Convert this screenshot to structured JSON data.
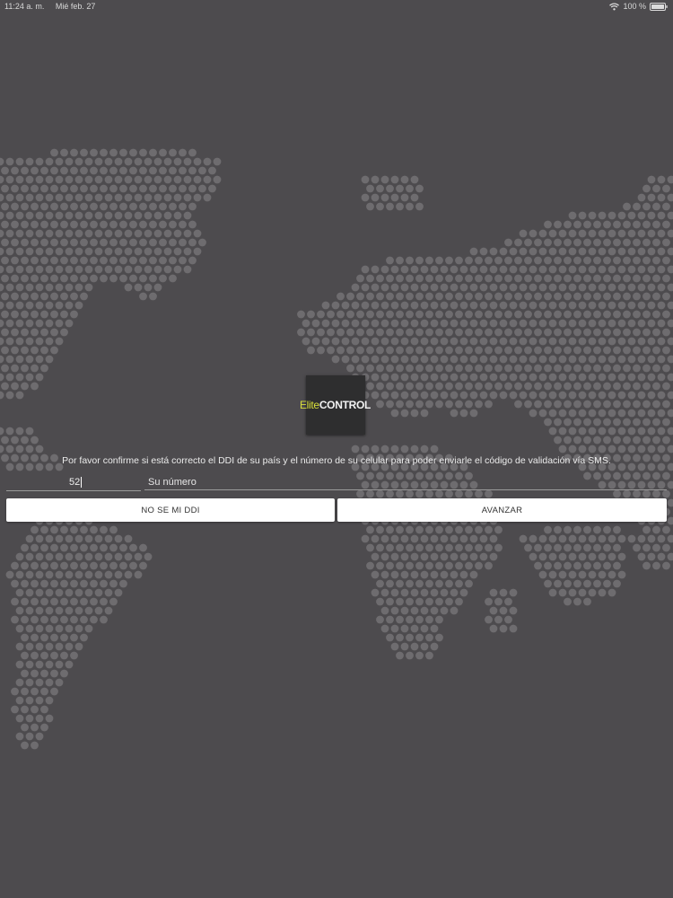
{
  "status_bar": {
    "time": "11:24 a. m.",
    "date": "Mié feb. 27",
    "battery": "100 %"
  },
  "logo": {
    "elite": "Elite",
    "control": "CONTROL"
  },
  "instructions": "Por favor confirme si está correcto el DDI de su país y el número de su celular para poder enviarle el código de validación vía SMS.",
  "form": {
    "ddi_value": "52",
    "phone_placeholder": "Su número",
    "no_ddi_label": "NO SE MI DDI",
    "next_label": "AVANZAR"
  },
  "colors": {
    "background": "#4d4b4e",
    "map_dots": "#6e6c6f",
    "accent": "#d8df3a",
    "button": "#ffffff"
  }
}
